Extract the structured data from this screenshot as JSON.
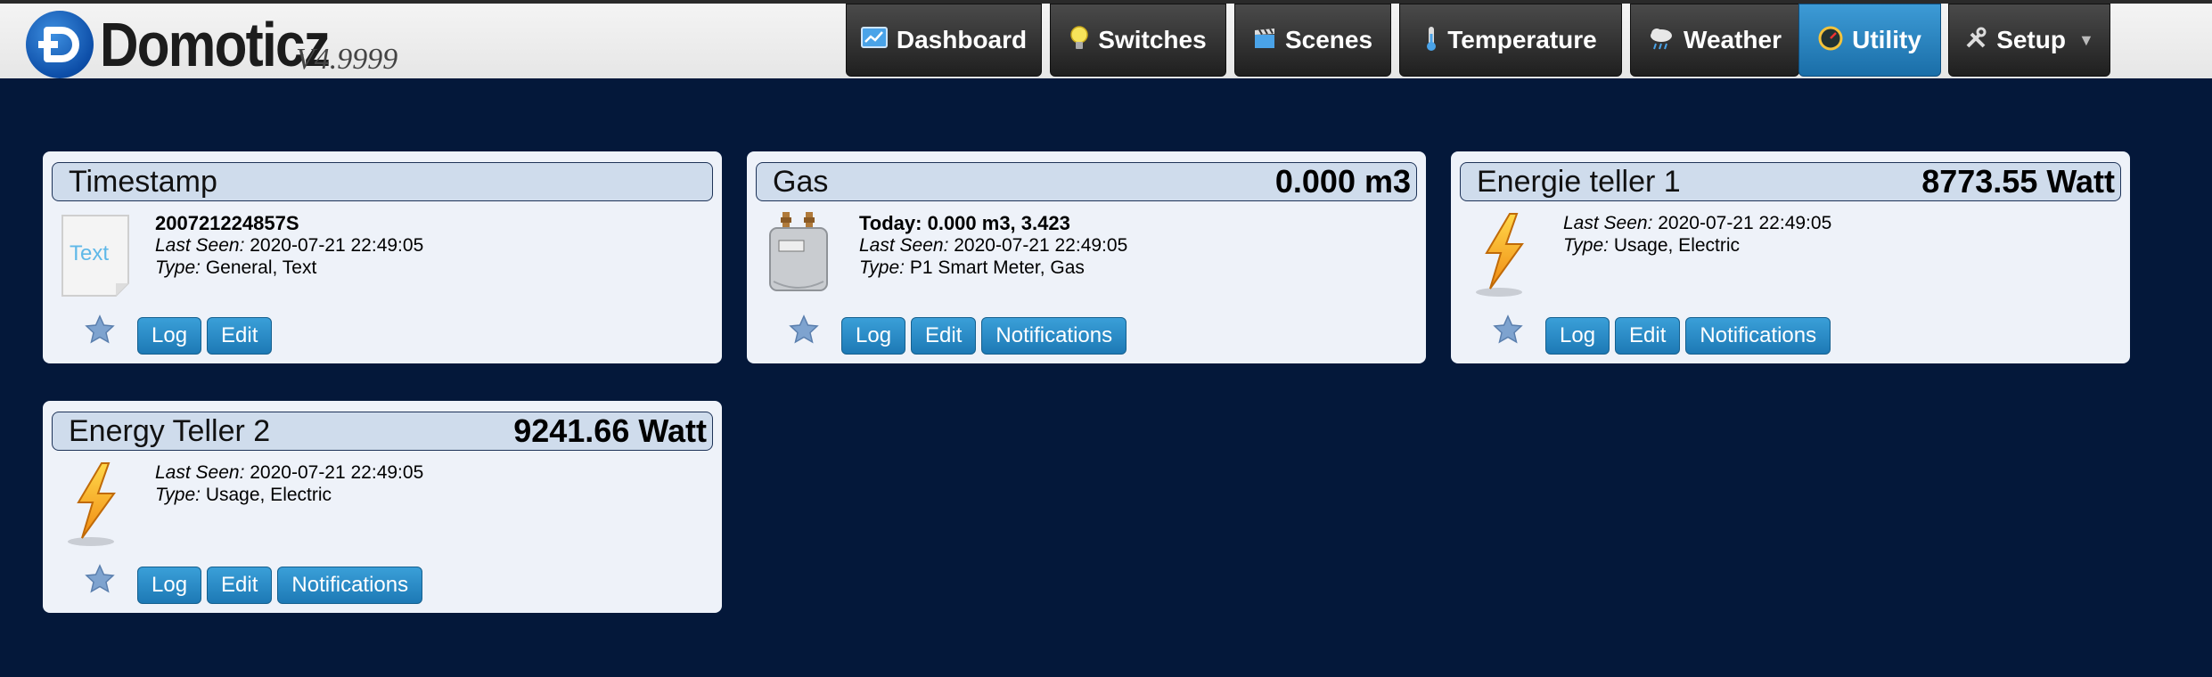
{
  "brand": {
    "name": "Domoticz",
    "version": "V4.9999"
  },
  "nav": [
    {
      "label": "Dashboard",
      "icon": "dashboard-icon"
    },
    {
      "label": "Switches",
      "icon": "lightbulb-icon"
    },
    {
      "label": "Scenes",
      "icon": "clapperboard-icon"
    },
    {
      "label": "Temperature",
      "icon": "thermometer-icon"
    },
    {
      "label": "Weather",
      "icon": "cloud-rain-icon"
    },
    {
      "label": "Utility",
      "icon": "gauge-icon",
      "active": true
    },
    {
      "label": "Setup",
      "icon": "tools-icon",
      "dropdown": true
    }
  ],
  "colors": {
    "background": "#04183a",
    "accent": "#2a8ac8"
  },
  "devices": [
    {
      "name": "Timestamp",
      "value": "",
      "icon": "text-icon",
      "status": "200721224857S",
      "last_seen_label": "Last Seen:",
      "last_seen": "2020-07-21 22:49:05",
      "type_label": "Type:",
      "type": "General, Text",
      "buttons": [
        "Log",
        "Edit"
      ]
    },
    {
      "name": "Gas",
      "value": "0.000 m3",
      "icon": "gas-meter-icon",
      "status": "Today: 0.000 m3, 3.423",
      "last_seen_label": "Last Seen:",
      "last_seen": "2020-07-21 22:49:05",
      "type_label": "Type:",
      "type": "P1 Smart Meter, Gas",
      "buttons": [
        "Log",
        "Edit",
        "Notifications"
      ]
    },
    {
      "name": "Energie teller 1",
      "value": "8773.55 Watt",
      "icon": "lightning-icon",
      "status": "",
      "last_seen_label": "Last Seen:",
      "last_seen": "2020-07-21 22:49:05",
      "type_label": "Type:",
      "type": "Usage, Electric",
      "buttons": [
        "Log",
        "Edit",
        "Notifications"
      ]
    },
    {
      "name": "Energy Teller 2",
      "value": "9241.66 Watt",
      "icon": "lightning-icon",
      "status": "",
      "last_seen_label": "Last Seen:",
      "last_seen": "2020-07-21 22:49:05",
      "type_label": "Type:",
      "type": "Usage, Electric",
      "buttons": [
        "Log",
        "Edit",
        "Notifications"
      ]
    }
  ]
}
